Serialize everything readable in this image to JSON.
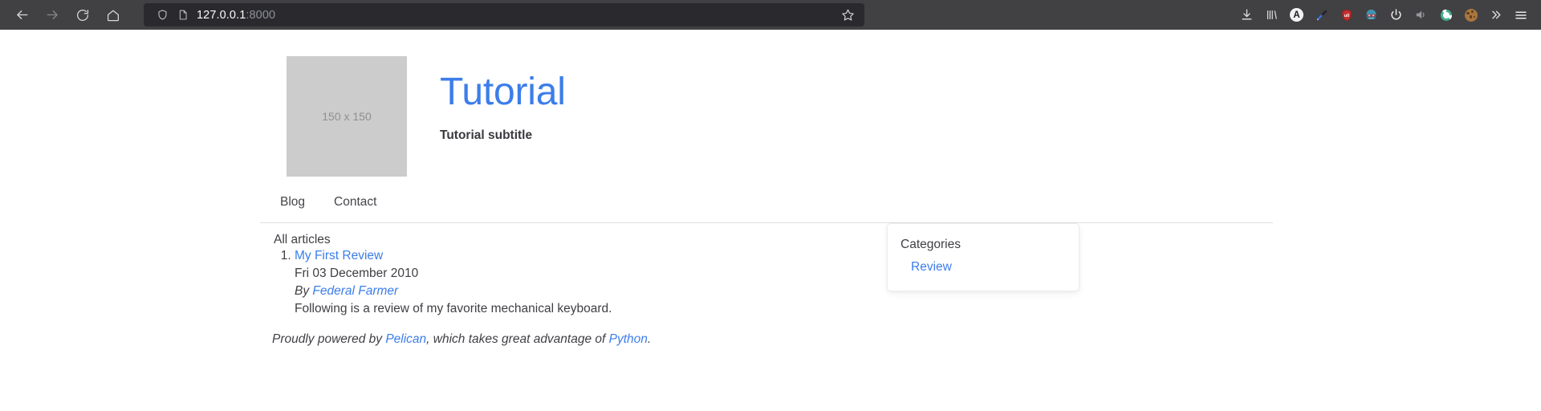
{
  "browser": {
    "nav": {
      "back": "Back",
      "forward": "Forward",
      "reload": "Reload",
      "home": "Home"
    },
    "url_bar": {
      "host": "127.0.0.1",
      "port": ":8000",
      "shield_icon": "shield-icon",
      "page_icon": "page-document-icon",
      "bookmark_icon": "star-outline-icon"
    },
    "extensions": [
      {
        "name": "downloads-icon",
        "label": "Downloads"
      },
      {
        "name": "library-icon",
        "label": "Library"
      },
      {
        "name": "account-a-icon",
        "label": "A"
      },
      {
        "name": "eyedropper-icon",
        "label": "Eyedropper"
      },
      {
        "name": "ublock-origin-icon",
        "label": "uO"
      },
      {
        "name": "robot-face-icon",
        "label": "Robot"
      },
      {
        "name": "power-icon",
        "label": "Power"
      },
      {
        "name": "speaker-icon",
        "label": "Sound"
      },
      {
        "name": "sync-refresh-icon",
        "label": "Sync"
      },
      {
        "name": "cookie-icon",
        "label": "Cookies"
      },
      {
        "name": "overflow-chevrons-icon",
        "label": "»"
      },
      {
        "name": "hamburger-menu-icon",
        "label": "Menu"
      }
    ]
  },
  "site": {
    "logo_placeholder": "150 x 150",
    "title": "Tutorial",
    "subtitle": "Tutorial subtitle",
    "nav": [
      {
        "label": "Blog"
      },
      {
        "label": "Contact"
      }
    ]
  },
  "main": {
    "all_articles_label": "All articles",
    "articles": [
      {
        "title": "My First Review",
        "date": "Fri 03 December 2010",
        "by_prefix": "By ",
        "author": "Federal Farmer",
        "summary": "Following is a review of my favorite mechanical keyboard."
      }
    ]
  },
  "sidebar": {
    "title": "Categories",
    "categories": [
      {
        "label": "Review"
      }
    ]
  },
  "footer": {
    "part1": "Proudly powered by ",
    "link1": "Pelican",
    "part2": ", which takes great advantage of ",
    "link2": "Python",
    "part3": "."
  },
  "colors": {
    "link_blue": "#3c7dea",
    "chrome_bg": "#414042",
    "urlbar_bg": "#2a2a2e",
    "placeholder_gray": "#cccccc"
  }
}
